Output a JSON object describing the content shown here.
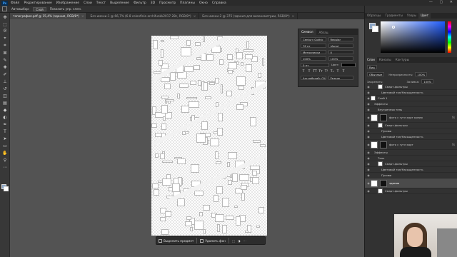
{
  "menubar": {
    "app_logo": "Ps",
    "items": [
      "Файл",
      "Редактирование",
      "Изображение",
      "Слои",
      "Текст",
      "Выделение",
      "Фильтр",
      "3D",
      "Просмотр",
      "Плагины",
      "Окно",
      "Справка"
    ],
    "window_controls": "— ▢ ✕"
  },
  "optbar": {
    "auto_select_label": "Автовыбор:",
    "auto_select_value": "Слой",
    "show_controls_label": "Показать упр. элем.",
    "share_label": "Поделиться"
  },
  "tabs": [
    {
      "label": "топография.pdf @ 15,4% (здания, RGB/8*)",
      "active": true
    },
    {
      "label": "Без имени-1 @ 66,7% (6-8 colonfinia archifunkk2017-28c, RGB/8*)",
      "active": false
    },
    {
      "label": "Без имени-2 @ 375 (здания для визонометрии, RGB/8*)",
      "active": false
    }
  ],
  "char_panel": {
    "tabs": [
      "Символ",
      "Абзац"
    ],
    "font_family": "Century Gothic",
    "font_style": "Regular",
    "size": "78 пт",
    "leading": "(Авто)",
    "kerning": "Метрически",
    "tracking": "0",
    "vert_scale": "100%",
    "horiz_scale": "100%",
    "baseline": "0 пт",
    "color_label": "Цвет:",
    "format_buttons": [
      "T",
      "T",
      "TT",
      "Tт",
      "T¹",
      "T₁",
      "T",
      "Ŧ"
    ],
    "language": "Английский: США",
    "aa": "Резкое"
  },
  "color_panel": {
    "tabs": [
      "Образцы",
      "Градиенты",
      "Узоры",
      "Цвет"
    ],
    "active": "Цвет",
    "foreground_hex": "#8aa4c4",
    "background_hex": "#ffffff"
  },
  "layers_panel": {
    "tabs": [
      "Слои",
      "Каналы",
      "Контуры"
    ],
    "filter_label": "Вид",
    "blend_mode": "Обычные",
    "opacity_label": "Непрозрачность:",
    "opacity": "100%",
    "lock_label": "Закрепить:",
    "fill_label": "Заливка:",
    "fill": "100%",
    "layers": [
      {
        "name": "Смарт-фильтры",
        "indent": 2,
        "type": "thumb"
      },
      {
        "name": "Цветовой тон/Насыщенность",
        "indent": 3,
        "type": "fx"
      },
      {
        "name": "Слой 1",
        "indent": 0,
        "type": "thumb"
      },
      {
        "name": "Эффекты",
        "indent": 1,
        "type": "fx"
      },
      {
        "name": "Внутренняя тень",
        "indent": 2,
        "type": "fx"
      },
      {
        "name": "фото с гугл карт копия",
        "indent": 0,
        "type": "tall",
        "fxmark": true
      },
      {
        "name": "Смарт-фильтры",
        "indent": 2,
        "type": "thumb"
      },
      {
        "name": "Пусиви",
        "indent": 3,
        "type": "fx"
      },
      {
        "name": "Цветовой тон/Насыщенность",
        "indent": 3,
        "type": "fx"
      },
      {
        "name": "фото с гугл карт",
        "indent": 0,
        "type": "tall",
        "fxmark": true
      },
      {
        "name": "Эффекты",
        "indent": 1,
        "type": "fx"
      },
      {
        "name": "Тень",
        "indent": 2,
        "type": "fx"
      },
      {
        "name": "Смарт-фильтры",
        "indent": 2,
        "type": "thumb"
      },
      {
        "name": "Цветовой тон/Насыщенность",
        "indent": 3,
        "type": "fx"
      },
      {
        "name": "Пусиви",
        "indent": 3,
        "type": "fx"
      },
      {
        "name": "здания",
        "indent": 0,
        "type": "tall",
        "selected": true
      },
      {
        "name": "Смарт-фильтры",
        "indent": 2,
        "type": "thumb"
      }
    ]
  },
  "context_bar": {
    "select_subject": "Выделить предмет",
    "remove_bg": "Удалить фон"
  }
}
